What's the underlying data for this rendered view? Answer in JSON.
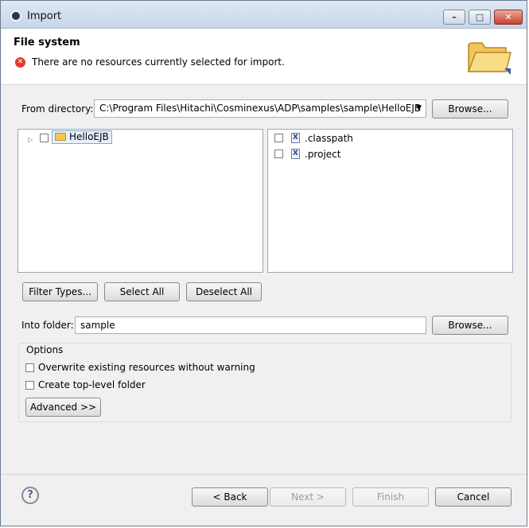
{
  "window": {
    "title": "Import",
    "controls": {
      "minimize": "–",
      "maximize": "□",
      "close": "✕"
    }
  },
  "header": {
    "title": "File system",
    "message": "There are no resources currently selected for import.",
    "error_icon_glyph": "✕",
    "graphic_icon": "folder-open-icon"
  },
  "from_directory": {
    "label": "From directory:",
    "value": "C:\\Program Files\\Hitachi\\Cosminexus\\ADP\\samples\\sample\\HelloEJB",
    "dropdown_glyph": "▼",
    "browse_label": "Browse..."
  },
  "tree": {
    "expand_glyph": "▷",
    "items": [
      {
        "label": "HelloEJB",
        "checked": false,
        "icon": "folder-icon"
      }
    ]
  },
  "files": {
    "items": [
      {
        "label": ".classpath",
        "checked": false,
        "icon": "xml-file-icon",
        "icon_glyph": "X"
      },
      {
        "label": ".project",
        "checked": false,
        "icon": "xml-file-icon",
        "icon_glyph": "X"
      }
    ]
  },
  "selection_buttons": {
    "filter_types": "Filter Types...",
    "select_all": "Select All",
    "deselect_all": "Deselect All"
  },
  "into_folder": {
    "label": "Into folder:",
    "value": "sample",
    "browse_label": "Browse..."
  },
  "options": {
    "label": "Options",
    "overwrite": {
      "label": "Overwrite existing resources without warning",
      "checked": false
    },
    "create_top_level": {
      "label": "Create top-level folder",
      "checked": false
    },
    "advanced_label": "Advanced >>"
  },
  "footer": {
    "help_glyph": "?",
    "back": "< Back",
    "next": "Next >",
    "finish": "Finish",
    "cancel": "Cancel"
  }
}
